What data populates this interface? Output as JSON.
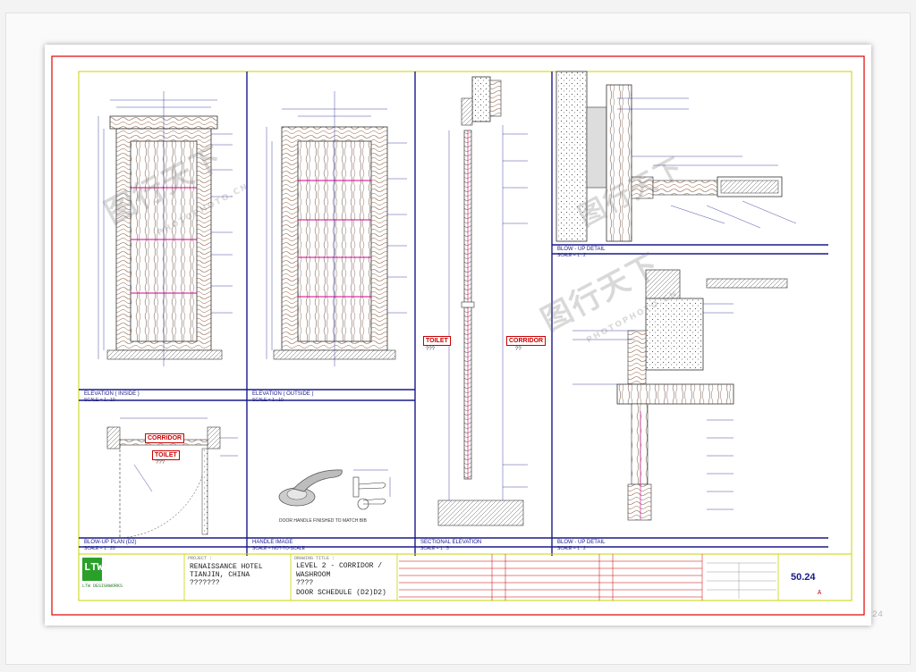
{
  "panels": {
    "p1": "ELEVATION ( INSIDE )",
    "p1_scale": "SCALE = 1 : 10",
    "p2": "ELEVATION ( OUTSIDE )",
    "p2_scale": "SCALE = 1 : 10",
    "p3": "SECTIONAL ELEVATION",
    "p3_scale": "SCALE = 1 : 5",
    "p4": "BLOW - UP DETAIL",
    "p4_scale": "SCALE = 1 : 2",
    "p5": "BLOW - UP DETAIL",
    "p5_scale": "SCALE = 1 : 2",
    "p6": "BLOW-UP PLAN (D2)",
    "p6_scale": "SCALE = 1 : 20",
    "p7": "HANDLE IMAGE",
    "p7_scale": "SCALE = NOT-TO-SCALE",
    "p8": "SECTIONAL ELEVATION",
    "p8_scale": "SCALE = 1 : 5",
    "p9": "BLOW - UP DETAIL",
    "p9_scale": "SCALE = 1 : 2"
  },
  "tags": {
    "toilet": "TOILET",
    "corridor": "CORRIDOR",
    "toilet_q": "???",
    "corridor_q": "??"
  },
  "handle_note": "DOOR HANDLE FINISHED TO MATCH BIB",
  "title_block": {
    "logo": "LTW",
    "logo_sub": "LTW DESIGNWORKS",
    "project_label": "PROJECT :",
    "project": "RENAISSANCE HOTEL",
    "project_loc": "TIANJIN, CHINA",
    "project_q": "???????",
    "drawing_title_label": "DRAWING TITLE :",
    "title_line1": "LEVEL 2 - CORRIDOR /",
    "title_line2": "WASHROOM",
    "title_line3": "????",
    "title_line4": "DOOR SCHEDULE (D2)D2)",
    "sheet_no": "50.24",
    "rev_mark": "A"
  },
  "watermark": {
    "main": "图行天下",
    "sub": "PHOTOPHOTO.CN"
  },
  "background_sheet_no": "24",
  "colors": {
    "border": "#e00000",
    "frame": "#c8d400",
    "panel": "#1a1a8c",
    "wood": "#b9846b",
    "accent": "#d0008c"
  }
}
